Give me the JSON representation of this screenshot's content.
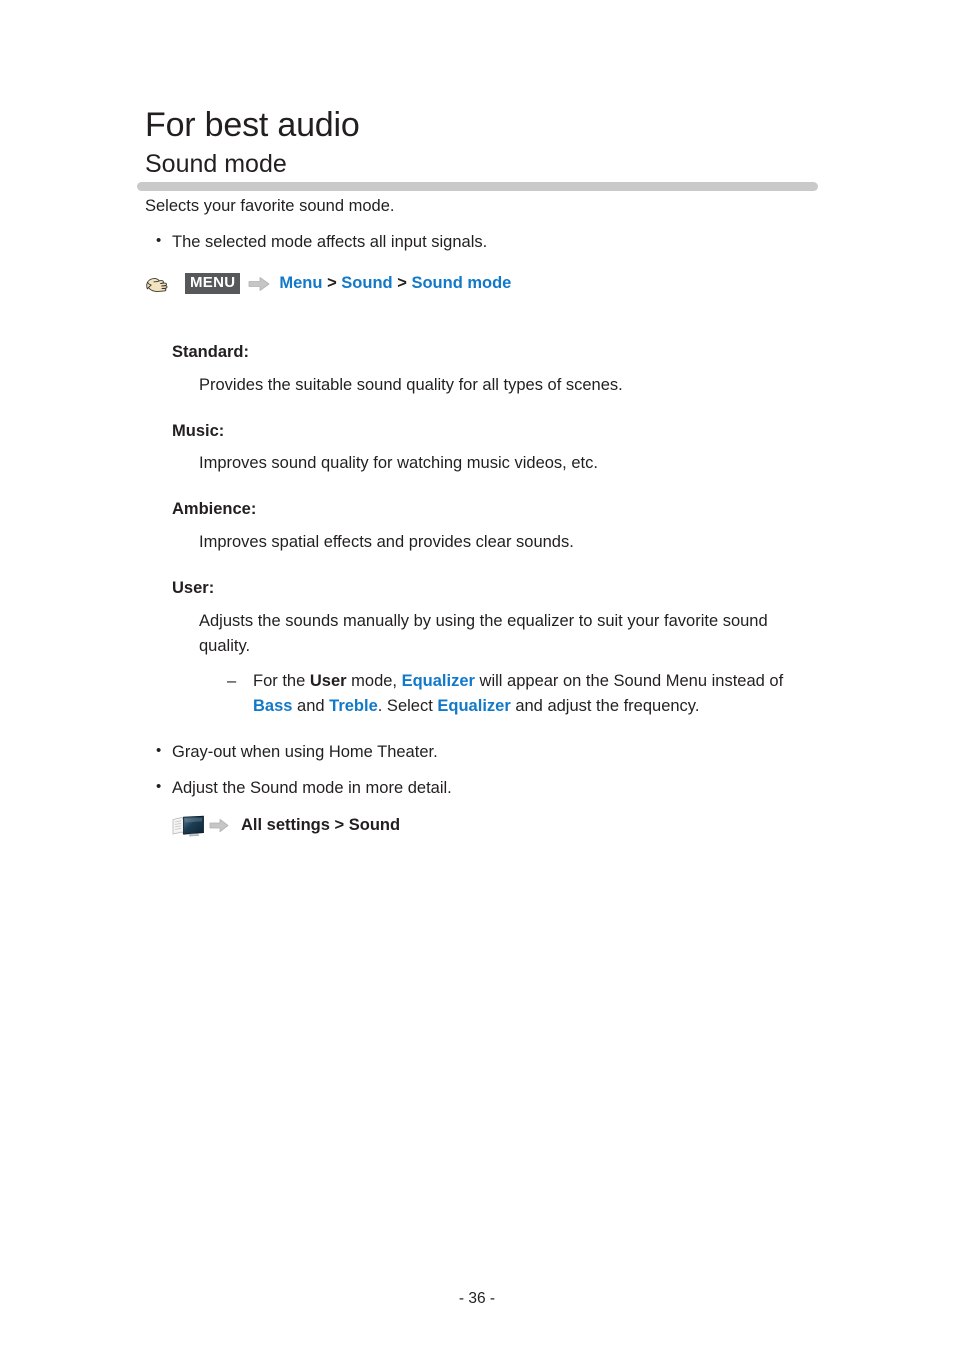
{
  "document": {
    "chapter_title": "For best audio",
    "section_title": "Sound mode",
    "lead": "Selects your favorite sound mode.",
    "intro_bullets": [
      "The selected mode affects all input signals."
    ],
    "menu_path": {
      "hand_icon": "pointing-hand-icon",
      "badge_label": "MENU",
      "arrow_icon": "right-arrow-icon",
      "parts": [
        {
          "text": "Menu",
          "style": "link"
        },
        {
          "text": ">",
          "style": "sep"
        },
        {
          "text": "Sound",
          "style": "link"
        },
        {
          "text": ">",
          "style": "sep"
        },
        {
          "text": "Sound mode",
          "style": "link"
        }
      ]
    },
    "modes": [
      {
        "term": "Standard",
        "colon": ":",
        "description": "Provides the suitable sound quality for all types of scenes."
      },
      {
        "term": "Music",
        "colon": ":",
        "description": "Improves sound quality for watching music videos, etc."
      },
      {
        "term": "Ambience",
        "colon": ":",
        "description": "Improves spatial effects and provides clear sounds."
      },
      {
        "term": "User",
        "colon": ":",
        "description": "Adjusts the sounds manually by using the equalizer to suit your favorite sound quality."
      }
    ],
    "user_note": {
      "seg1": "For the ",
      "seg2_bold": "User",
      "seg3": " mode, ",
      "seg4_link": "Equalizer",
      "seg5": " will appear on the Sound Menu instead of ",
      "seg6_link": "Bass",
      "seg7": " and ",
      "seg8_link": "Treble",
      "seg9": ". Select ",
      "seg10_link": "Equalizer",
      "seg11": " and adjust the frequency."
    },
    "tail_bullets": [
      "Gray-out when using Home Theater.",
      "Adjust the Sound mode in more detail."
    ],
    "settings_path": {
      "book_icon": "emanual-tv-icon",
      "arrow_icon": "right-arrow-icon",
      "parts": [
        {
          "text": "All settings",
          "style": "bold"
        },
        {
          "text": ">",
          "style": "sep"
        },
        {
          "text": "Sound",
          "style": "bold"
        }
      ]
    },
    "page_number": "- 36 -",
    "colors": {
      "link_blue": "#1279c9",
      "rule_gray": "#c9c9c9",
      "badge_gray": "#57585a",
      "text_black": "#231f20"
    }
  }
}
